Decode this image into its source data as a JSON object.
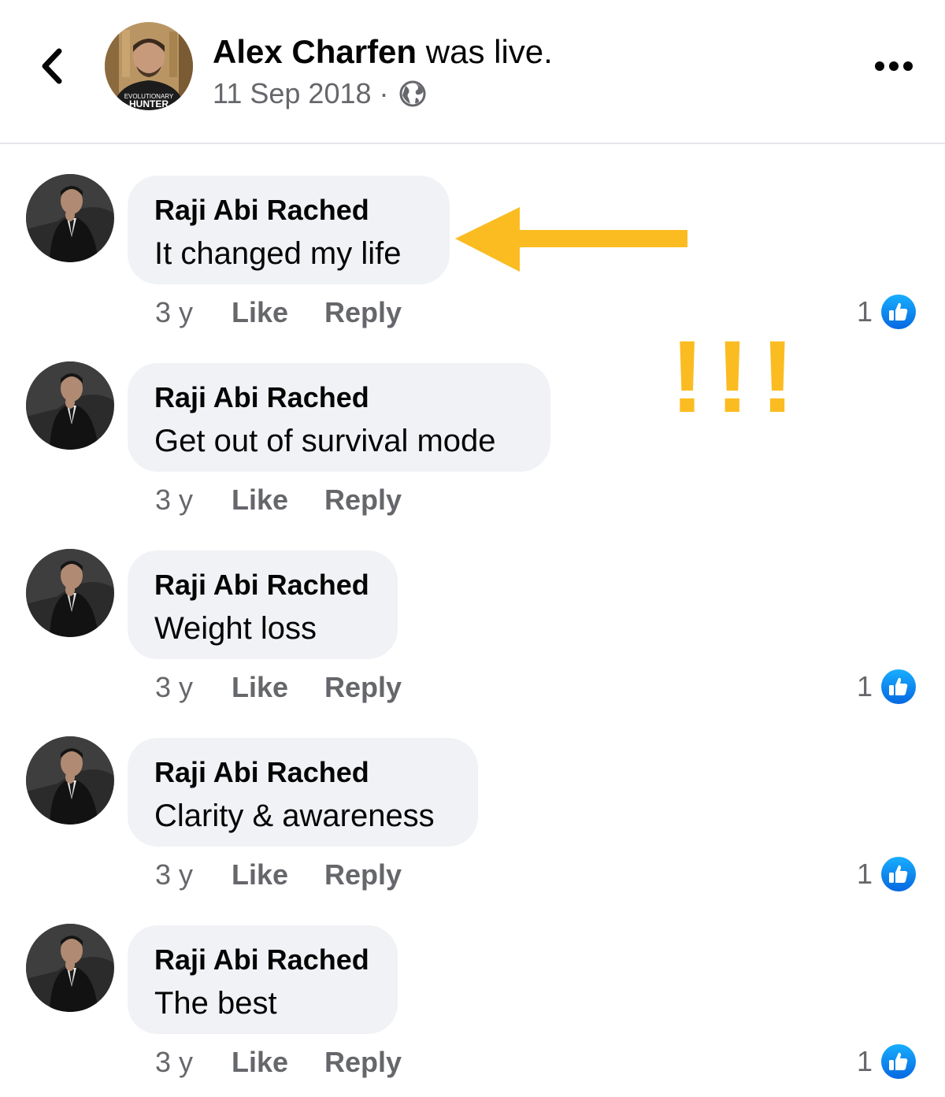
{
  "header": {
    "author": "Alex Charfen",
    "status_suffix": "was live.",
    "date": "11 Sep 2018 ·",
    "avatar_shirt_top": "EVOLUTIONARY",
    "avatar_shirt_bottom": "HUNTER"
  },
  "comments": [
    {
      "name": "Raji Abi Rached",
      "text": "It changed my life",
      "time": "3 y",
      "like": "Like",
      "reply": "Reply",
      "reactions": "1"
    },
    {
      "name": "Raji Abi Rached",
      "text": "Get out of survival mode",
      "time": "3 y",
      "like": "Like",
      "reply": "Reply",
      "reactions": ""
    },
    {
      "name": "Raji Abi Rached",
      "text": "Weight loss",
      "time": "3 y",
      "like": "Like",
      "reply": "Reply",
      "reactions": "1"
    },
    {
      "name": "Raji Abi Rached",
      "text": "Clarity & awareness",
      "time": "3 y",
      "like": "Like",
      "reply": "Reply",
      "reactions": "1"
    },
    {
      "name": "Raji Abi Rached",
      "text": "The best",
      "time": "3 y",
      "like": "Like",
      "reply": "Reply",
      "reactions": "1"
    }
  ],
  "annotations": {
    "exclamation": "!!!",
    "color": "#fbbc22"
  },
  "colors": {
    "bubble_bg": "#f0f2f5",
    "secondary_text": "#65676b",
    "like_blue": "#1877f2"
  }
}
